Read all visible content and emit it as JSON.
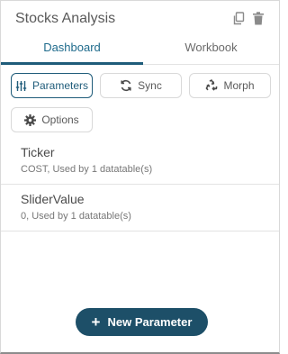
{
  "panel": {
    "title": "Stocks Analysis"
  },
  "icons": {
    "duplicate": "copy-icon",
    "delete": "trash-icon"
  },
  "tabs": [
    {
      "label": "Dashboard",
      "active": true
    },
    {
      "label": "Workbook",
      "active": false
    }
  ],
  "actions": {
    "parameters": "Parameters",
    "sync": "Sync",
    "morph": "Morph",
    "options": "Options"
  },
  "parameters": [
    {
      "name": "Ticker",
      "meta": "COST, Used by 1 datatable(s)"
    },
    {
      "name": "SliderValue",
      "meta": "0, Used by 1 datatable(s)"
    }
  ],
  "footer": {
    "new_parameter": "New Parameter"
  },
  "colors": {
    "accent": "#1f5c7a",
    "primary_button": "#1d4f68"
  }
}
